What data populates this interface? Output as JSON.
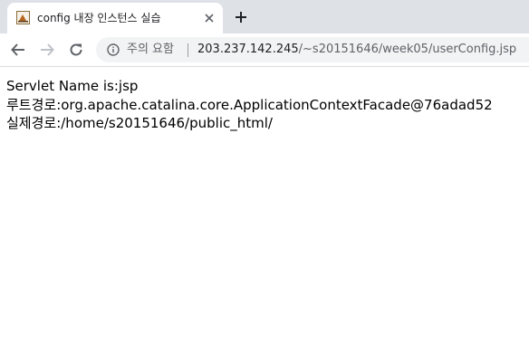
{
  "browser": {
    "tab": {
      "title": "config 내장 인스턴스 실습",
      "favicon": "page-favicon-icon",
      "close": "close-icon"
    },
    "new_tab": "plus-icon",
    "nav": {
      "back": "arrow-left-icon",
      "forward": "arrow-right-icon",
      "reload": "reload-icon"
    },
    "omnibox": {
      "security_icon": "info-icon",
      "security_label": "주의 요함",
      "url_host": "203.237.142.245",
      "url_path": "/~s20151646/week05/userConfig.jsp"
    }
  },
  "page": {
    "lines": [
      "Servlet Name is:jsp",
      "루트경로:org.apache.catalina.core.ApplicationContextFacade@76adad52",
      "실제경로:/home/s20151646/public_html/"
    ]
  },
  "colors": {
    "tab_strip": "#dee1e6",
    "omnibox_bg": "#f1f3f4",
    "text": "#000000",
    "url_host": "#202124",
    "url_path": "#5f6368"
  }
}
